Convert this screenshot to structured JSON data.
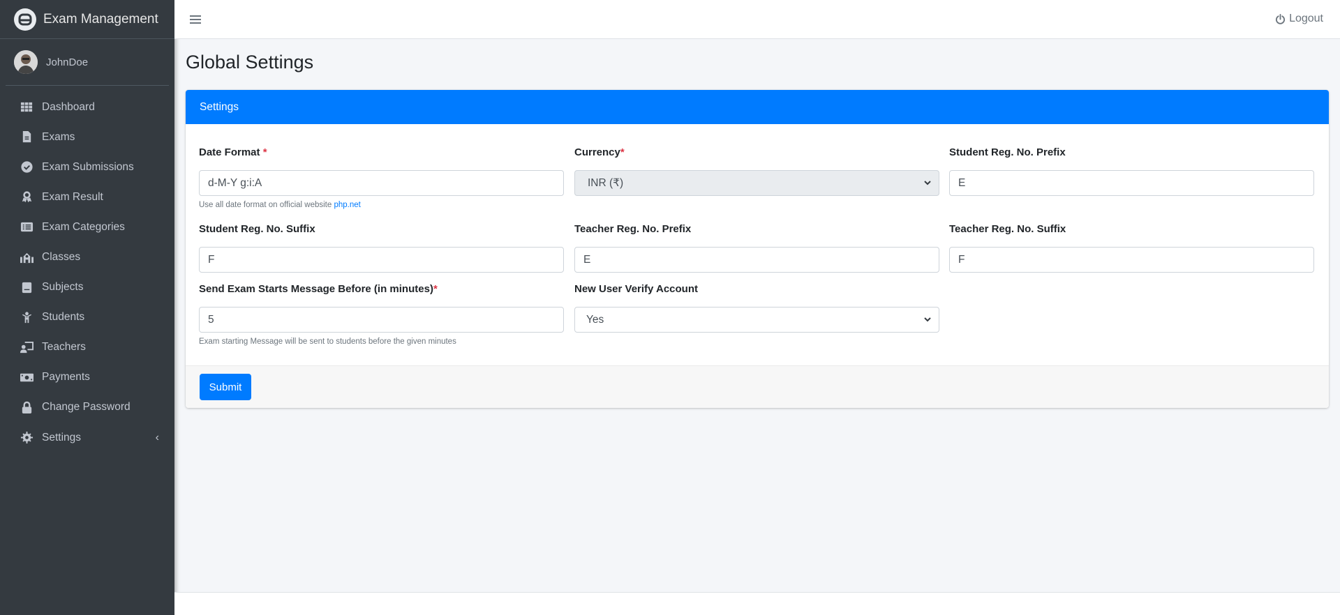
{
  "app": {
    "title": "Exam Management"
  },
  "user": {
    "name": "JohnDoe"
  },
  "sidebar": {
    "items": [
      {
        "label": "Dashboard",
        "icon": "grid-icon"
      },
      {
        "label": "Exams",
        "icon": "file-icon"
      },
      {
        "label": "Exam Submissions",
        "icon": "check-circle-icon"
      },
      {
        "label": "Exam Result",
        "icon": "award-icon"
      },
      {
        "label": "Exam Categories",
        "icon": "list-icon"
      },
      {
        "label": "Classes",
        "icon": "school-icon"
      },
      {
        "label": "Subjects",
        "icon": "book-icon"
      },
      {
        "label": "Students",
        "icon": "child-icon"
      },
      {
        "label": "Teachers",
        "icon": "teacher-icon"
      },
      {
        "label": "Payments",
        "icon": "money-icon"
      },
      {
        "label": "Change Password",
        "icon": "lock-icon"
      },
      {
        "label": "Settings",
        "icon": "gear-icon",
        "has_submenu": true
      }
    ]
  },
  "topbar": {
    "logout_label": "Logout"
  },
  "page": {
    "title": "Global Settings"
  },
  "card": {
    "header": "Settings",
    "submit_label": "Submit"
  },
  "fields": {
    "date_format": {
      "label": "Date Format ",
      "value": "d-M-Y g:i:A",
      "help": "Use all date format on official website ",
      "help_link": "php.net"
    },
    "currency": {
      "label": "Currency",
      "value": "INR (₹)"
    },
    "student_prefix": {
      "label": "Student Reg. No. Prefix",
      "value": "E"
    },
    "student_suffix": {
      "label": "Student Reg. No. Suffix",
      "value": "F"
    },
    "teacher_prefix": {
      "label": "Teacher Reg. No. Prefix",
      "value": "E"
    },
    "teacher_suffix": {
      "label": "Teacher Reg. No. Suffix",
      "value": "F"
    },
    "exam_message": {
      "label": "Send Exam Starts Message Before (in minutes)",
      "value": "5",
      "help": "Exam starting Message will be sent to students before the given minutes"
    },
    "verify": {
      "label": "New User Verify Account",
      "value": "Yes"
    }
  },
  "required_mark": "*",
  "colors": {
    "primary": "#007bff",
    "sidebar": "#343a40",
    "required": "#dc3545"
  }
}
